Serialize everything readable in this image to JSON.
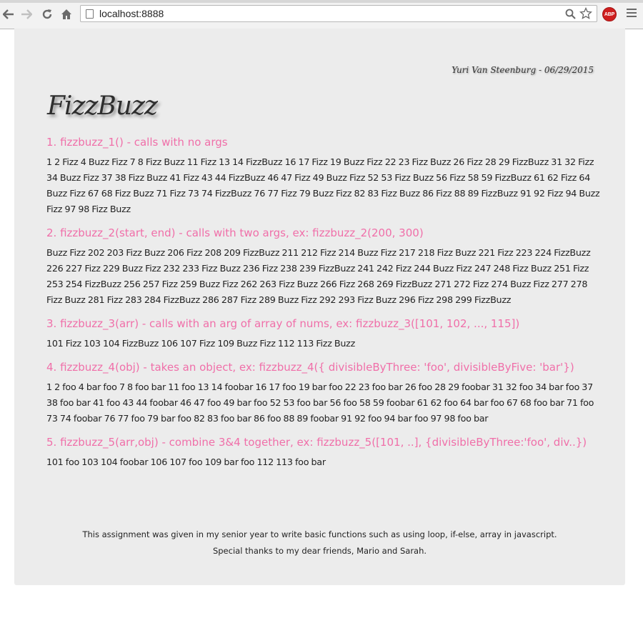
{
  "browser": {
    "url": "localhost:8888",
    "icons": {
      "back": "back-arrow-icon",
      "forward": "forward-arrow-icon",
      "reload": "reload-icon",
      "home": "home-icon",
      "page": "page-icon",
      "zoom": "search-icon",
      "bookmark": "star-icon",
      "extension": "adblock-icon",
      "menu": "hamburger-menu-icon"
    },
    "extension_label": "ABP"
  },
  "page": {
    "signature": "Yuri Van Steenburg - 06/29/2015",
    "title": "FizzBuzz",
    "sections": [
      {
        "heading": "1. fizzbuzz_1() - calls with no args",
        "output": "1 2 Fizz 4 Buzz Fizz 7 8 Fizz Buzz 11 Fizz 13 14 FizzBuzz 16 17 Fizz 19 Buzz Fizz 22 23 Fizz Buzz 26 Fizz 28 29 FizzBuzz 31 32 Fizz 34 Buzz Fizz 37 38 Fizz Buzz 41 Fizz 43 44 FizzBuzz 46 47 Fizz 49 Buzz Fizz 52 53 Fizz Buzz 56 Fizz 58 59 FizzBuzz 61 62 Fizz 64 Buzz Fizz 67 68 Fizz Buzz 71 Fizz 73 74 FizzBuzz 76 77 Fizz 79 Buzz Fizz 82 83 Fizz Buzz 86 Fizz 88 89 FizzBuzz 91 92 Fizz 94 Buzz Fizz 97 98 Fizz Buzz"
      },
      {
        "heading": "2. fizzbuzz_2(start, end) - calls with two args, ex: fizzbuzz_2(200, 300)",
        "output": "Buzz Fizz 202 203 Fizz Buzz 206 Fizz 208 209 FizzBuzz 211 212 Fizz 214 Buzz Fizz 217 218 Fizz Buzz 221 Fizz 223 224 FizzBuzz 226 227 Fizz 229 Buzz Fizz 232 233 Fizz Buzz 236 Fizz 238 239 FizzBuzz 241 242 Fizz 244 Buzz Fizz 247 248 Fizz Buzz 251 Fizz 253 254 FizzBuzz 256 257 Fizz 259 Buzz Fizz 262 263 Fizz Buzz 266 Fizz 268 269 FizzBuzz 271 272 Fizz 274 Buzz Fizz 277 278 Fizz Buzz 281 Fizz 283 284 FizzBuzz 286 287 Fizz 289 Buzz Fizz 292 293 Fizz Buzz 296 Fizz 298 299 FizzBuzz"
      },
      {
        "heading": "3. fizzbuzz_3(arr) - calls with an arg of array of nums, ex: fizzbuzz_3([101, 102, ..., 115])",
        "output": "101 Fizz 103 104 FizzBuzz 106 107 Fizz 109 Buzz Fizz 112 113 Fizz Buzz"
      },
      {
        "heading": "4. fizzbuzz_4(obj) - takes an object, ex: fizzbuzz_4({ divisibleByThree: 'foo', divisibleByFive: 'bar'})",
        "output": "1 2 foo 4 bar foo 7 8 foo bar 11 foo 13 14 foobar 16 17 foo 19 bar foo 22 23 foo bar 26 foo 28 29 foobar 31 32 foo 34 bar foo 37 38 foo bar 41 foo 43 44 foobar 46 47 foo 49 bar foo 52 53 foo bar 56 foo 58 59 foobar 61 62 foo 64 bar foo 67 68 foo bar 71 foo 73 74 foobar 76 77 foo 79 bar foo 82 83 foo bar 86 foo 88 89 foobar 91 92 foo 94 bar foo 97 98 foo bar"
      },
      {
        "heading": "5. fizzbuzz_5(arr,obj) - combine 3&4 together, ex: fizzbuzz_5([101, ..], {divisibleByThree:'foo', div..})",
        "output": "101 foo 103 104 foobar 106 107 foo 109 bar foo 112 113 foo bar"
      }
    ],
    "footer": {
      "line1": "This assignment was given in my senior year to write basic functions such as using loop, if-else, array in javascript.",
      "line2": "Special thanks to my dear friends, Mario and Sarah."
    }
  },
  "colors": {
    "heading": "#f06fa9",
    "panel_background": "#ececec",
    "body_text": "#222222"
  }
}
